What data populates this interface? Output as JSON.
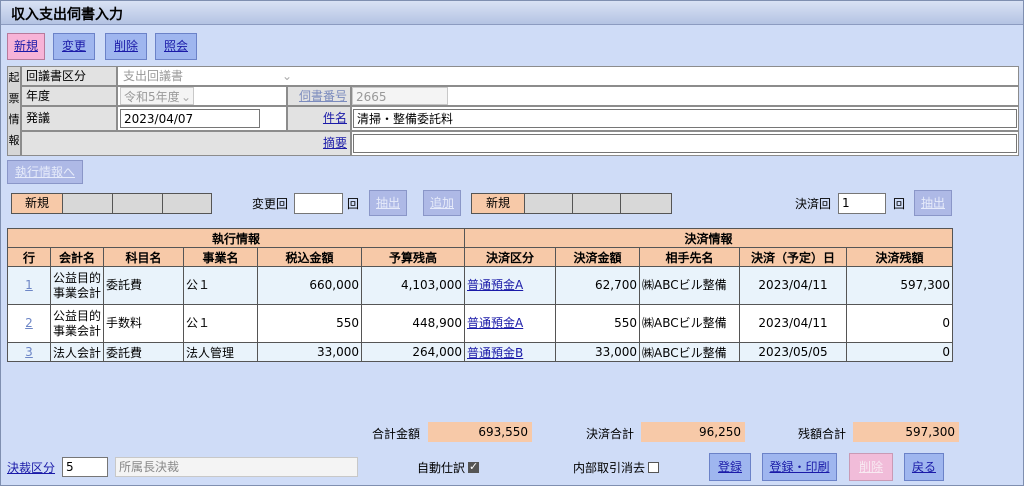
{
  "window": {
    "title": "収入支出伺書入力"
  },
  "toolbar": {
    "new": "新規",
    "change": "変更",
    "delete": "削除",
    "browse": "照会"
  },
  "kihyo": {
    "side_label": [
      "起",
      "票",
      "情",
      "報"
    ],
    "doc_type_label": "回議書区分",
    "doc_type_value": "支出回議書",
    "year_label": "年度",
    "year_value": "令和5年度",
    "doc_no_label": "伺書番号",
    "doc_no_value": "2665",
    "issue_label": "発議",
    "issue_value": "2023/04/07",
    "subject_label": "件名",
    "subject_value": "清掃・整備委託料",
    "summary_label": "摘要",
    "summary_value": ""
  },
  "exec_info_button": "執行情報へ",
  "exec_filter": {
    "mode": "新規",
    "change_count_label": "変更回",
    "change_count_value": "",
    "count_unit": "回",
    "extract": "抽出",
    "add": "追加"
  },
  "settle_filter": {
    "mode": "新規",
    "settle_count_label": "決済回",
    "settle_count_value": "1",
    "count_unit": "回",
    "extract": "抽出"
  },
  "grid": {
    "group_exec": "執行情報",
    "group_settle": "決済情報",
    "headers": [
      "行",
      "会計名",
      "科目名",
      "事業名",
      "税込金額",
      "予算残高",
      "決済区分",
      "決済金額",
      "相手先名",
      "決済（予定）日",
      "決済残額"
    ],
    "rows": [
      {
        "no": "1",
        "account": "公益目的事業会計",
        "subject": "委託費",
        "project": "公１",
        "amount": "660,000",
        "budget": "4,103,000",
        "settle_type": "普通預金A",
        "settle_amount": "62,700",
        "partner": "㈱ABCビル整備",
        "date": "2023/04/11",
        "remain": "597,300"
      },
      {
        "no": "2",
        "account": "公益目的事業会計",
        "subject": "手数料",
        "project": "公１",
        "amount": "550",
        "budget": "448,900",
        "settle_type": "普通預金A",
        "settle_amount": "550",
        "partner": "㈱ABCビル整備",
        "date": "2023/04/11",
        "remain": "0"
      },
      {
        "no": "3",
        "account": "法人会計",
        "subject": "委託費",
        "project": "法人管理",
        "amount": "33,000",
        "budget": "264,000",
        "settle_type": "普通預金B",
        "settle_amount": "33,000",
        "partner": "㈱ABCビル整備",
        "date": "2023/05/05",
        "remain": "0"
      }
    ]
  },
  "totals": {
    "total_label": "合計金額",
    "total_value": "693,550",
    "settle_label": "決済合計",
    "settle_value": "96,250",
    "remain_label": "残額合計",
    "remain_value": "597,300"
  },
  "footer": {
    "decision_label": "決裁区分",
    "decision_code": "5",
    "decision_name": "所属長決裁",
    "auto_journal_label": "自動仕訳",
    "auto_journal_checked": true,
    "internal_cancel_label": "内部取引消去",
    "internal_cancel_checked": false,
    "register": "登録",
    "register_print": "登録・印刷",
    "delete": "削除",
    "back": "戻る"
  }
}
